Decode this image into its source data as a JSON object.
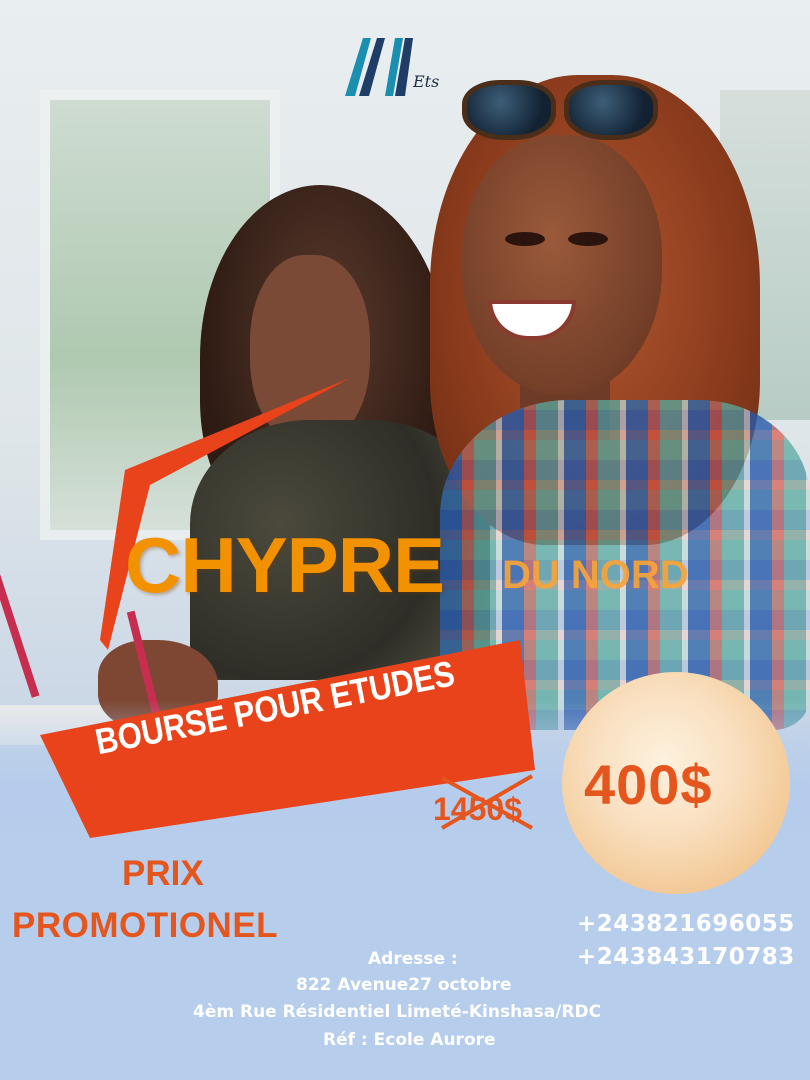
{
  "logo": {
    "text": "Ets",
    "icon": "mountain-logo-icon"
  },
  "headline": {
    "main": "CHYPRE",
    "secondary": "DU NORD"
  },
  "banner": {
    "label": "BOURSE POUR ETUDES"
  },
  "pricing": {
    "old_price": "1450$",
    "new_price": "400$"
  },
  "promo": {
    "line1": "PRIX",
    "line2": "PROMOTIONEL"
  },
  "contact": {
    "phone1": "+243821696055",
    "phone2": "+243843170783"
  },
  "address": {
    "label": "Adresse :",
    "line1": "822 Avenue27 octobre",
    "line2": "4èm Rue Résidentiel Limeté-Kinshasa/RDC",
    "ref": "Réf : Ecole Aurore"
  },
  "colors": {
    "accent": "#e4561e",
    "headline": "#f39200",
    "banner": "#e8431a",
    "background_bottom": "#b5ccec"
  }
}
